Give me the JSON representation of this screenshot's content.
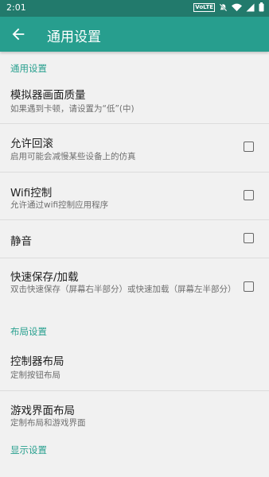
{
  "status_bar": {
    "time": "2:01",
    "network_badge": "VoLTE",
    "icons": [
      "mute-icon",
      "wifi-icon",
      "signal-icon",
      "battery-icon"
    ]
  },
  "app_bar": {
    "title": "通用设置",
    "back_icon": "arrow-left-icon"
  },
  "sections": [
    {
      "header": "通用设置",
      "items": [
        {
          "title": "模拟器画面质量",
          "subtitle": "如果遇到卡顿，请设置为“低”(中)"
        },
        {
          "title": "允许回滚",
          "subtitle": "启用可能会减慢某些设备上的仿真",
          "checked": false
        },
        {
          "title": "Wifi控制",
          "subtitle": "允许通过wifi控制应用程序",
          "checked": false
        },
        {
          "title": "静音",
          "checked": false
        },
        {
          "title": "快速保存/加载",
          "subtitle": "双击快速保存（屏幕右半部分）或快速加载（屏幕左半部分）",
          "checked": false
        }
      ]
    },
    {
      "header": "布局设置",
      "items": [
        {
          "title": "控制器布局",
          "subtitle": "定制按钮布局"
        },
        {
          "title": "游戏界面布局",
          "subtitle": "定制布局和游戏界面"
        }
      ]
    },
    {
      "header": "显示设置"
    }
  ],
  "colors": {
    "status_bar": "#227a6c",
    "app_bar": "#279e8e",
    "accent": "#29a08f",
    "background": "#f1f1f1"
  }
}
